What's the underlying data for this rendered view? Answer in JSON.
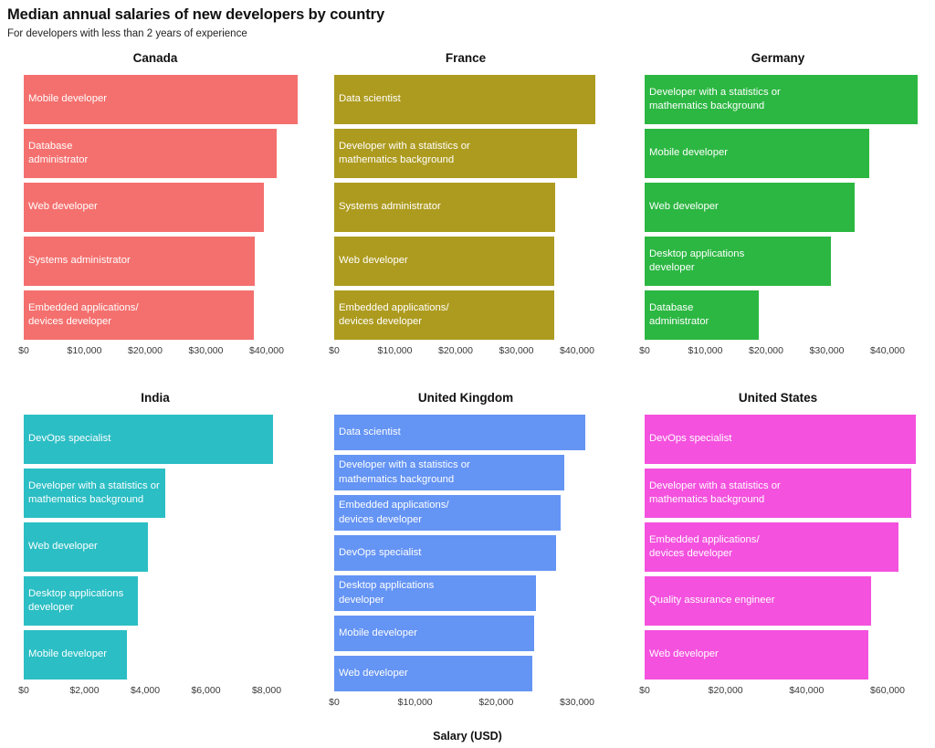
{
  "header": {
    "title": "Median annual salaries of new developers by country",
    "subtitle": "For developers with less than 2 years of experience"
  },
  "axis_title": "Salary (USD)",
  "chart_data": {
    "type": "bar",
    "orientation": "horizontal",
    "title": "Median annual salaries of new developers by country",
    "subtitle": "For developers with less than 2 years of experience",
    "xlabel": "Salary (USD)",
    "ylabel": "",
    "grid": false,
    "legend": "none",
    "facet_layout": [
      3,
      2
    ],
    "note": "Each country facet has its own independent x-axis scale; bars are sorted descending and labeled in-bar with the developer role.",
    "facets": [
      {
        "name": "Canada",
        "color": "#F4706E",
        "xlim": [
          0,
          45000
        ],
        "xticks": [
          0,
          10000,
          20000,
          30000,
          40000
        ],
        "xticklabels": [
          "$0",
          "$10,000",
          "$20,000",
          "$30,000",
          "$40,000"
        ],
        "categories": [
          "Mobile developer",
          "Database administrator",
          "Web developer",
          "Systems administrator",
          "Embedded applications/ devices developer"
        ],
        "labels": [
          "Mobile developer",
          "Database\nadministrator",
          "Web developer",
          "Systems administrator",
          "Embedded applications/\ndevices developer"
        ],
        "values": [
          45100,
          41600,
          39500,
          38000,
          37900
        ]
      },
      {
        "name": "France",
        "color": "#AD9B1F",
        "xlim": [
          0,
          43000
        ],
        "xticks": [
          0,
          10000,
          20000,
          30000,
          40000
        ],
        "xticklabels": [
          "$0",
          "$10,000",
          "$20,000",
          "$30,000",
          "$40,000"
        ],
        "categories": [
          "Data scientist",
          "Developer with a statistics or mathematics background",
          "Systems administrator",
          "Web developer",
          "Embedded applications/ devices developer"
        ],
        "labels": [
          "Data scientist",
          "Developer with a statistics or\nmathematics background",
          "Systems administrator",
          "Web developer",
          "Embedded applications/\ndevices developer"
        ],
        "values": [
          43000,
          40000,
          36400,
          36300,
          36200
        ]
      },
      {
        "name": "Germany",
        "color": "#2CB742",
        "xlim": [
          0,
          45000
        ],
        "xticks": [
          0,
          10000,
          20000,
          30000,
          40000
        ],
        "xticklabels": [
          "$0",
          "$10,000",
          "$20,000",
          "$30,000",
          "$40,000"
        ],
        "categories": [
          "Developer with a statistics or mathematics background",
          "Mobile developer",
          "Web developer",
          "Desktop applications developer",
          "Database administrator"
        ],
        "labels": [
          "Developer with a statistics or\nmathematics background",
          "Mobile developer",
          "Web developer",
          "Desktop applications\ndeveloper",
          "Database\nadministrator"
        ],
        "values": [
          45000,
          37000,
          34600,
          30700,
          18800
        ]
      },
      {
        "name": "India",
        "color": "#2BBEC4",
        "xlim": [
          0,
          8200
        ],
        "xticks": [
          0,
          2000,
          4000,
          6000,
          8000
        ],
        "xticklabels": [
          "$0",
          "$2,000",
          "$4,000",
          "$6,000",
          "$8,000"
        ],
        "categories": [
          "DevOps specialist",
          "Developer with a statistics or mathematics background",
          "Web developer",
          "Desktop applications developer",
          "Mobile developer"
        ],
        "labels": [
          "DevOps specialist",
          "Developer with a statistics or\nmathematics background",
          "Web developer",
          "Desktop applications\ndeveloper",
          "Mobile developer"
        ],
        "values": [
          8200,
          4650,
          4100,
          3750,
          3400
        ]
      },
      {
        "name": "United Kingdom",
        "color": "#6494F4",
        "xlim": [
          0,
          31000
        ],
        "xticks": [
          0,
          10000,
          20000,
          30000
        ],
        "xticklabels": [
          "$0",
          "$10,000",
          "$20,000",
          "$30,000"
        ],
        "categories": [
          "Data scientist",
          "Developer with a statistics or mathematics background",
          "Embedded applications/ devices developer",
          "DevOps specialist",
          "Desktop applications developer",
          "Mobile developer",
          "Web developer"
        ],
        "labels": [
          "Data scientist",
          "Developer with a statistics or\nmathematics background",
          "Embedded applications/\ndevices developer",
          "DevOps specialist",
          "Desktop applications\ndeveloper",
          "Mobile developer",
          "Web developer"
        ],
        "values": [
          31000,
          28400,
          28000,
          27400,
          24900,
          24700,
          24500
        ]
      },
      {
        "name": "United States",
        "color": "#F451DE",
        "xlim": [
          0,
          67000
        ],
        "xticks": [
          0,
          20000,
          40000,
          60000
        ],
        "xticklabels": [
          "$0",
          "$20,000",
          "$40,000",
          "$60,000"
        ],
        "categories": [
          "DevOps specialist",
          "Developer with a statistics or mathematics background",
          "Embedded applications/ devices developer",
          "Quality assurance engineer",
          "Web developer"
        ],
        "labels": [
          "DevOps specialist",
          "Developer with a statistics or\nmathematics background",
          "Embedded applications/\ndevices developer",
          "Quality assurance engineer",
          "Web developer"
        ],
        "values": [
          67000,
          65800,
          62600,
          56000,
          55200
        ]
      }
    ]
  }
}
